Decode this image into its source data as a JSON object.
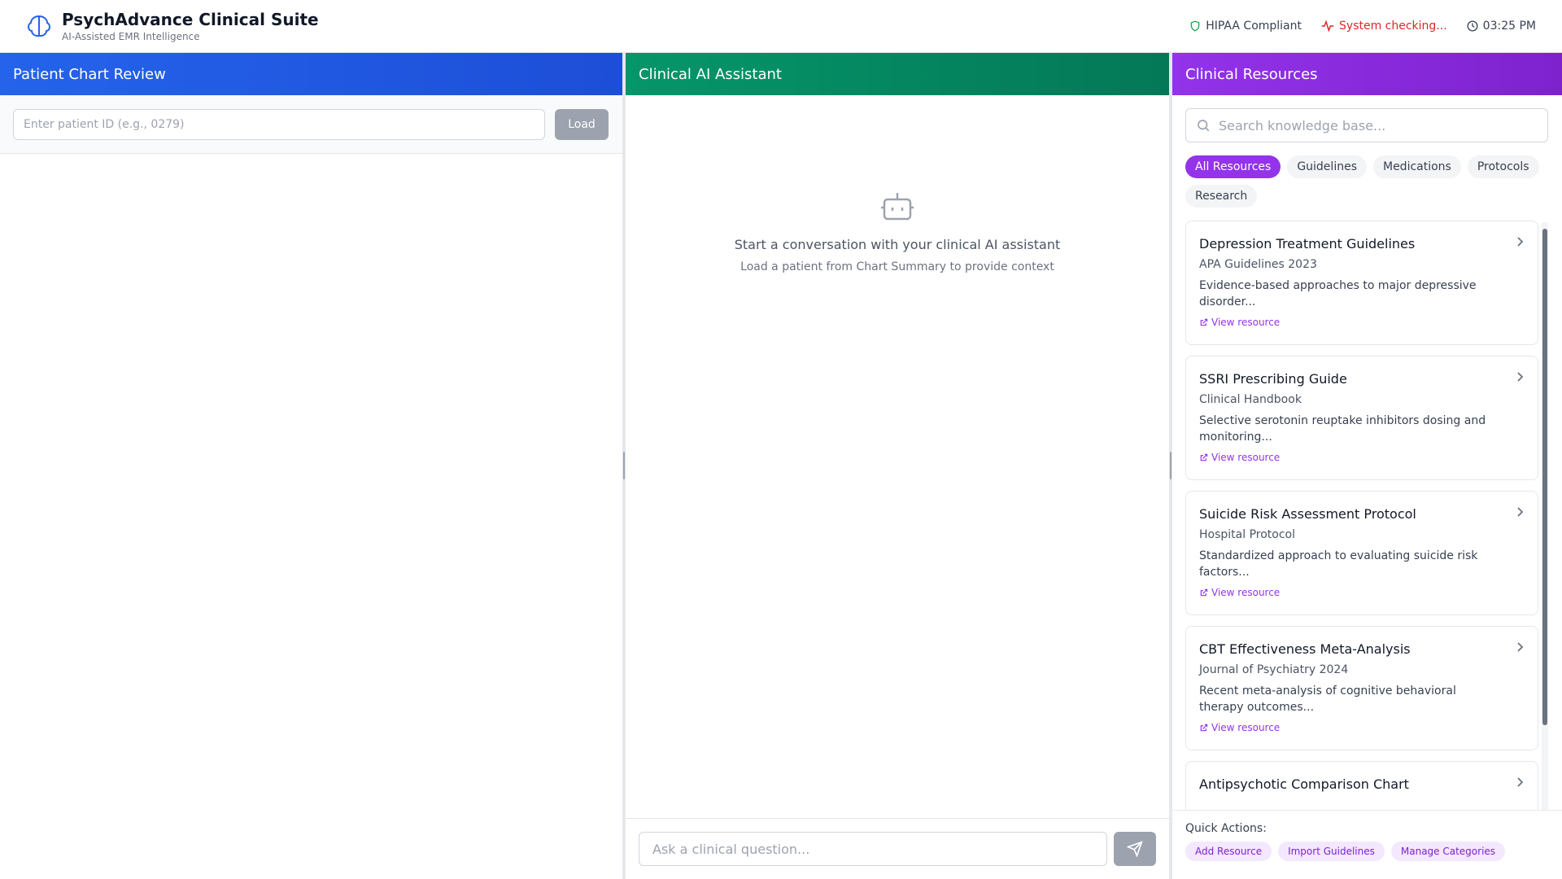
{
  "header": {
    "title": "PsychAdvance Clinical Suite",
    "subtitle": "AI-Assisted EMR Intelligence",
    "hipaa": "HIPAA Compliant",
    "system_status": "System checking...",
    "time": "03:25 PM"
  },
  "left_panel": {
    "title": "Patient Chart Review",
    "patient_input_placeholder": "Enter patient ID (e.g., 0279)",
    "load_label": "Load"
  },
  "mid_panel": {
    "title": "Clinical AI Assistant",
    "empty_title": "Start a conversation with your clinical AI assistant",
    "empty_sub": "Load a patient from Chart Summary to provide context",
    "chat_placeholder": "Ask a clinical question..."
  },
  "right_panel": {
    "title": "Clinical Resources",
    "search_placeholder": "Search knowledge base...",
    "filters": [
      "All Resources",
      "Guidelines",
      "Medications",
      "Protocols",
      "Research"
    ],
    "resources": [
      {
        "title": "Depression Treatment Guidelines",
        "source": "APA Guidelines 2023",
        "desc": "Evidence-based approaches to major depressive disorder...",
        "link": "View resource"
      },
      {
        "title": "SSRI Prescribing Guide",
        "source": "Clinical Handbook",
        "desc": "Selective serotonin reuptake inhibitors dosing and monitoring...",
        "link": "View resource"
      },
      {
        "title": "Suicide Risk Assessment Protocol",
        "source": "Hospital Protocol",
        "desc": "Standardized approach to evaluating suicide risk factors...",
        "link": "View resource"
      },
      {
        "title": "CBT Effectiveness Meta-Analysis",
        "source": "Journal of Psychiatry 2024",
        "desc": "Recent meta-analysis of cognitive behavioral therapy outcomes...",
        "link": "View resource"
      },
      {
        "title": "Antipsychotic Comparison Chart",
        "source": "",
        "desc": "",
        "link": ""
      }
    ],
    "quick_label": "Quick Actions:",
    "quick_actions": [
      "Add Resource",
      "Import Guidelines",
      "Manage Categories"
    ]
  },
  "colors": {
    "blue": "#2563eb",
    "green": "#059669",
    "purple": "#9333ea",
    "red": "#dc2626"
  }
}
